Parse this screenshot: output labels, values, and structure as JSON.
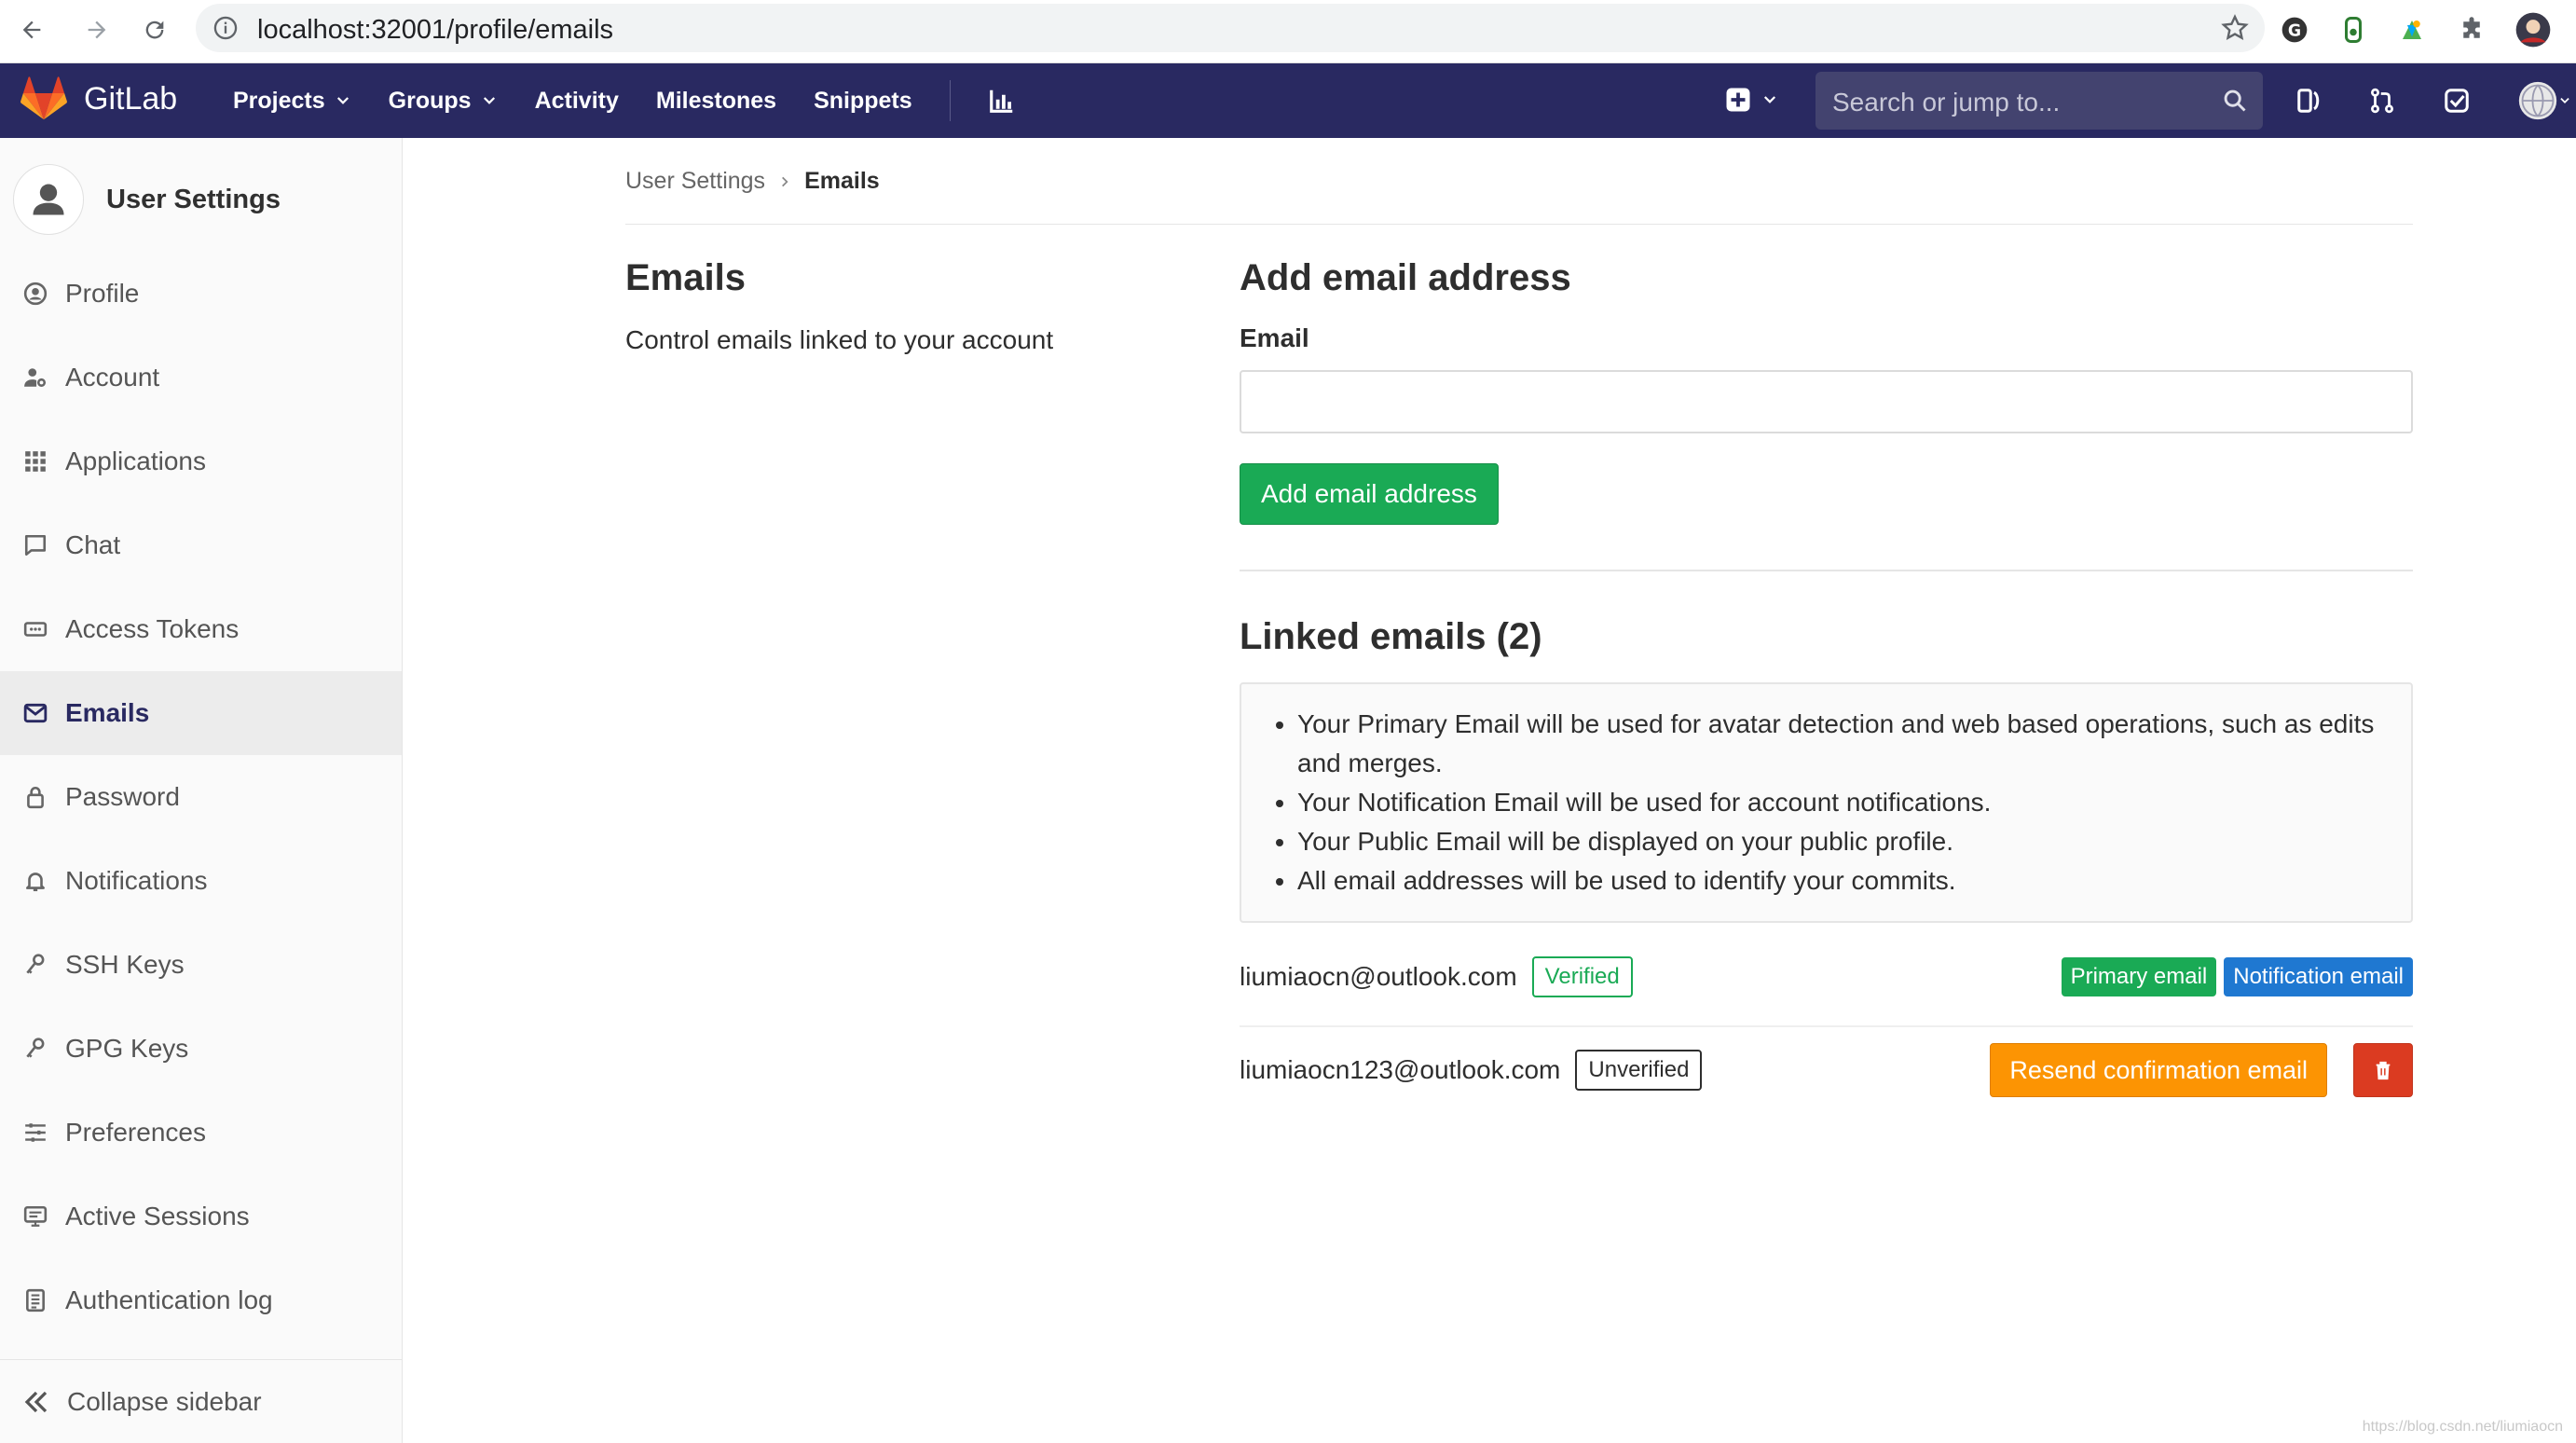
{
  "browser": {
    "url": "localhost:32001/profile/emails"
  },
  "header": {
    "logo_text": "GitLab",
    "nav": [
      {
        "label": "Projects",
        "has_dropdown": true
      },
      {
        "label": "Groups",
        "has_dropdown": true
      },
      {
        "label": "Activity",
        "has_dropdown": false
      },
      {
        "label": "Milestones",
        "has_dropdown": false
      },
      {
        "label": "Snippets",
        "has_dropdown": false
      }
    ],
    "search_placeholder": "Search or jump to...",
    "bg_color": "#292961"
  },
  "sidebar": {
    "title": "User Settings",
    "items": [
      {
        "label": "Profile",
        "icon": "profile-icon"
      },
      {
        "label": "Account",
        "icon": "account-icon"
      },
      {
        "label": "Applications",
        "icon": "applications-icon"
      },
      {
        "label": "Chat",
        "icon": "chat-icon"
      },
      {
        "label": "Access Tokens",
        "icon": "token-icon"
      },
      {
        "label": "Emails",
        "icon": "mail-icon",
        "active": true
      },
      {
        "label": "Password",
        "icon": "lock-icon"
      },
      {
        "label": "Notifications",
        "icon": "bell-icon"
      },
      {
        "label": "SSH Keys",
        "icon": "key-icon"
      },
      {
        "label": "GPG Keys",
        "icon": "key-icon"
      },
      {
        "label": "Preferences",
        "icon": "preferences-icon"
      },
      {
        "label": "Active Sessions",
        "icon": "monitor-icon"
      },
      {
        "label": "Authentication log",
        "icon": "log-icon"
      }
    ],
    "collapse_label": "Collapse sidebar"
  },
  "breadcrumb": {
    "parent": "User Settings",
    "current": "Emails"
  },
  "section": {
    "title": "Emails",
    "description": "Control emails linked to your account"
  },
  "add_form": {
    "title": "Add email address",
    "email_label": "Email",
    "email_value": "",
    "submit_label": "Add email address"
  },
  "linked": {
    "title": "Linked emails (2)",
    "info": [
      "Your Primary Email will be used for avatar detection and web based operations, such as edits and merges.",
      "Your Notification Email will be used for account notifications.",
      "Your Public Email will be displayed on your public profile.",
      "All email addresses will be used to identify your commits."
    ],
    "emails": [
      {
        "address": "liumiaocn@outlook.com",
        "status": "Verified",
        "badges": [
          "Primary email",
          "Notification email"
        ]
      },
      {
        "address": "liumiaocn123@outlook.com",
        "status": "Unverified",
        "resend_label": "Resend confirmation email"
      }
    ]
  },
  "colors": {
    "success": "#1aaa55",
    "info": "#1f78d1",
    "warning": "#fc9403",
    "danger": "#db3b21"
  },
  "watermark": "https://blog.csdn.net/liumiaocn"
}
